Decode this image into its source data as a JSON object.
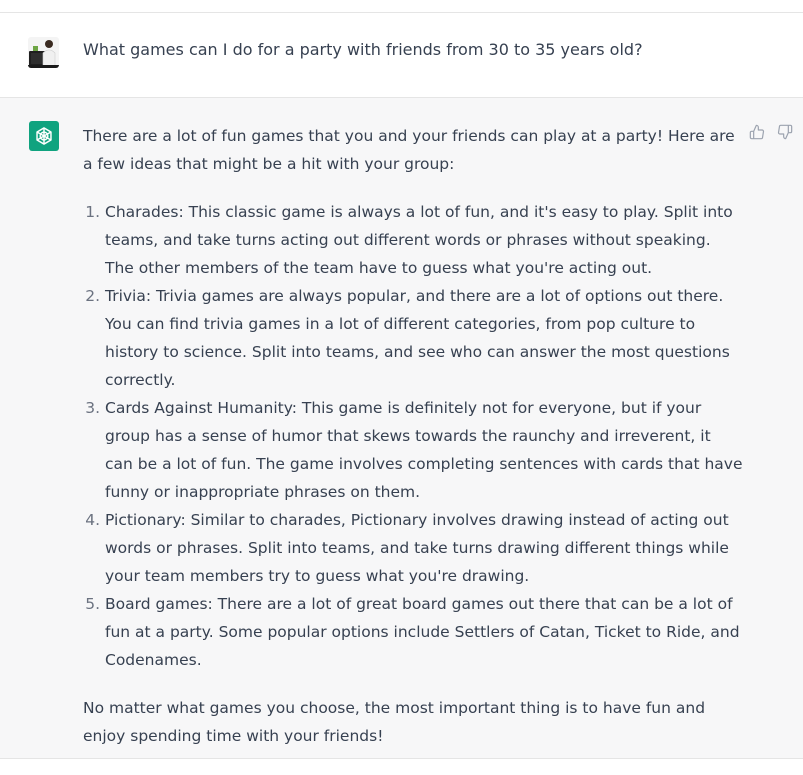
{
  "user_message": {
    "avatar": "user-photo-icon",
    "text": "What games can I do for a party with friends from 30 to 35 years old?"
  },
  "assistant_message": {
    "avatar": "openai-logo-icon",
    "intro": "There are a lot of fun games that you and your friends can play at a party! Here are a few ideas that might be a hit with your group:",
    "items": [
      "Charades: This classic game is always a lot of fun, and it's easy to play. Split into teams, and take turns acting out different words or phrases without speaking. The other members of the team have to guess what you're acting out.",
      "Trivia: Trivia games are always popular, and there are a lot of options out there. You can find trivia games in a lot of different categories, from pop culture to history to science. Split into teams, and see who can answer the most questions correctly.",
      "Cards Against Humanity: This game is definitely not for everyone, but if your group has a sense of humor that skews towards the raunchy and irreverent, it can be a lot of fun. The game involves completing sentences with cards that have funny or inappropriate phrases on them.",
      "Pictionary: Similar to charades, Pictionary involves drawing instead of acting out words or phrases. Split into teams, and take turns drawing different things while your team members try to guess what you're drawing.",
      "Board games: There are a lot of great board games out there that can be a lot of fun at a party. Some popular options include Settlers of Catan, Ticket to Ride, and Codenames."
    ],
    "outro": "No matter what games you choose, the most important thing is to have fun and enjoy spending time with your friends!",
    "feedback": {
      "thumbs_up": "thumbs-up-icon",
      "thumbs_down": "thumbs-down-icon"
    }
  },
  "colors": {
    "assistant_bg": "#f7f7f8",
    "brand_green": "#10a37f",
    "text": "#374151",
    "divider": "#e5e5e5"
  }
}
